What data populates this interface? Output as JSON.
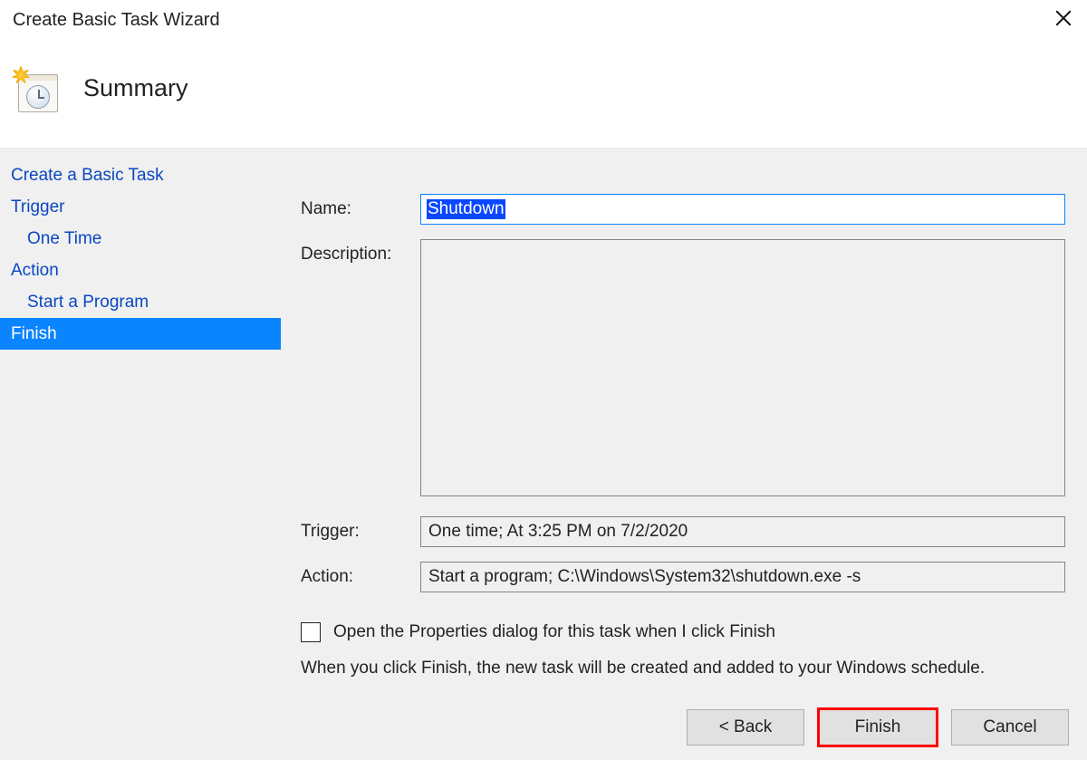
{
  "titlebar": {
    "title": "Create Basic Task Wizard"
  },
  "header": {
    "heading": "Summary"
  },
  "sidebar": {
    "items": [
      {
        "label": "Create a Basic Task",
        "indent": 0,
        "color": "link",
        "selected": false
      },
      {
        "label": "Trigger",
        "indent": 0,
        "color": "link",
        "selected": false
      },
      {
        "label": "One Time",
        "indent": 1,
        "color": "link",
        "selected": false
      },
      {
        "label": "Action",
        "indent": 0,
        "color": "link",
        "selected": false
      },
      {
        "label": "Start a Program",
        "indent": 1,
        "color": "link",
        "selected": false
      },
      {
        "label": "Finish",
        "indent": 0,
        "color": "white",
        "selected": true
      }
    ]
  },
  "form": {
    "name_label": "Name:",
    "name_value": "Shutdown",
    "description_label": "Description:",
    "description_value": "",
    "trigger_label": "Trigger:",
    "trigger_value": "One time; At 3:25 PM on 7/2/2020",
    "action_label": "Action:",
    "action_value": "Start a program; C:\\Windows\\System32\\shutdown.exe -s"
  },
  "checkbox": {
    "label": "Open the Properties dialog for this task when I click Finish",
    "checked": false
  },
  "hint_text": "When you click Finish, the new task will be created and added to your Windows schedule.",
  "buttons": {
    "back": "<  Back",
    "finish": "Finish",
    "cancel": "Cancel"
  }
}
